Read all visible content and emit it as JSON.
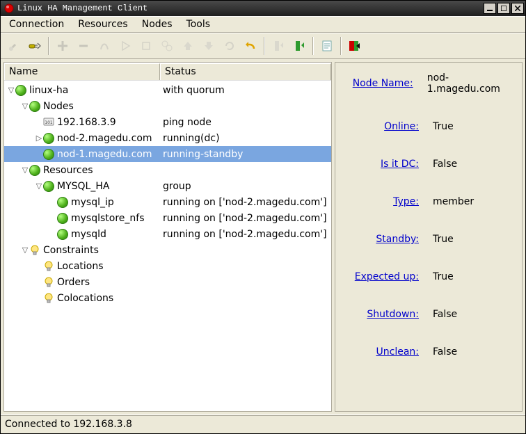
{
  "window": {
    "title": "Linux HA Management Client"
  },
  "menu": {
    "items": [
      "Connection",
      "Resources",
      "Nodes",
      "Tools"
    ]
  },
  "tree": {
    "headers": {
      "name": "Name",
      "status": "Status"
    },
    "rows": [
      {
        "indent": 0,
        "exp": "open",
        "icon": "green",
        "name": "linux-ha",
        "status": "with quorum",
        "sel": false
      },
      {
        "indent": 1,
        "exp": "open",
        "icon": "green",
        "name": "Nodes",
        "status": "",
        "sel": false
      },
      {
        "indent": 2,
        "exp": "none",
        "icon": "host",
        "name": "192.168.3.9",
        "status": "ping node",
        "sel": false
      },
      {
        "indent": 2,
        "exp": "closed",
        "icon": "green",
        "name": "nod-2.magedu.com",
        "status": "running(dc)",
        "sel": false
      },
      {
        "indent": 2,
        "exp": "none",
        "icon": "green",
        "name": "nod-1.magedu.com",
        "status": "running-standby",
        "sel": true
      },
      {
        "indent": 1,
        "exp": "open",
        "icon": "green",
        "name": "Resources",
        "status": "",
        "sel": false
      },
      {
        "indent": 2,
        "exp": "open",
        "icon": "green",
        "name": "MYSQL_HA",
        "status": "group",
        "sel": false
      },
      {
        "indent": 3,
        "exp": "none",
        "icon": "green",
        "name": "mysql_ip",
        "status": "running on ['nod-2.magedu.com']",
        "sel": false
      },
      {
        "indent": 3,
        "exp": "none",
        "icon": "green",
        "name": "mysqlstore_nfs",
        "status": "running on ['nod-2.magedu.com']",
        "sel": false
      },
      {
        "indent": 3,
        "exp": "none",
        "icon": "green",
        "name": "mysqld",
        "status": "running on ['nod-2.magedu.com']",
        "sel": false
      },
      {
        "indent": 1,
        "exp": "open",
        "icon": "bulb",
        "name": "Constraints",
        "status": "",
        "sel": false
      },
      {
        "indent": 2,
        "exp": "none",
        "icon": "bulb",
        "name": "Locations",
        "status": "",
        "sel": false
      },
      {
        "indent": 2,
        "exp": "none",
        "icon": "bulb",
        "name": "Orders",
        "status": "",
        "sel": false
      },
      {
        "indent": 2,
        "exp": "none",
        "icon": "bulb",
        "name": "Colocations",
        "status": "",
        "sel": false
      }
    ]
  },
  "props": [
    {
      "label": "Node Name:",
      "value": "nod-1.magedu.com"
    },
    {
      "label": "Online:",
      "value": "True"
    },
    {
      "label": "Is it DC:",
      "value": "False"
    },
    {
      "label": "Type:",
      "value": "member"
    },
    {
      "label": "Standby:",
      "value": "True"
    },
    {
      "label": "Expected up:",
      "value": "True"
    },
    {
      "label": "Shutdown:",
      "value": "False"
    },
    {
      "label": "Unclean:",
      "value": "False"
    }
  ],
  "statusbar": "Connected to 192.168.3.8"
}
